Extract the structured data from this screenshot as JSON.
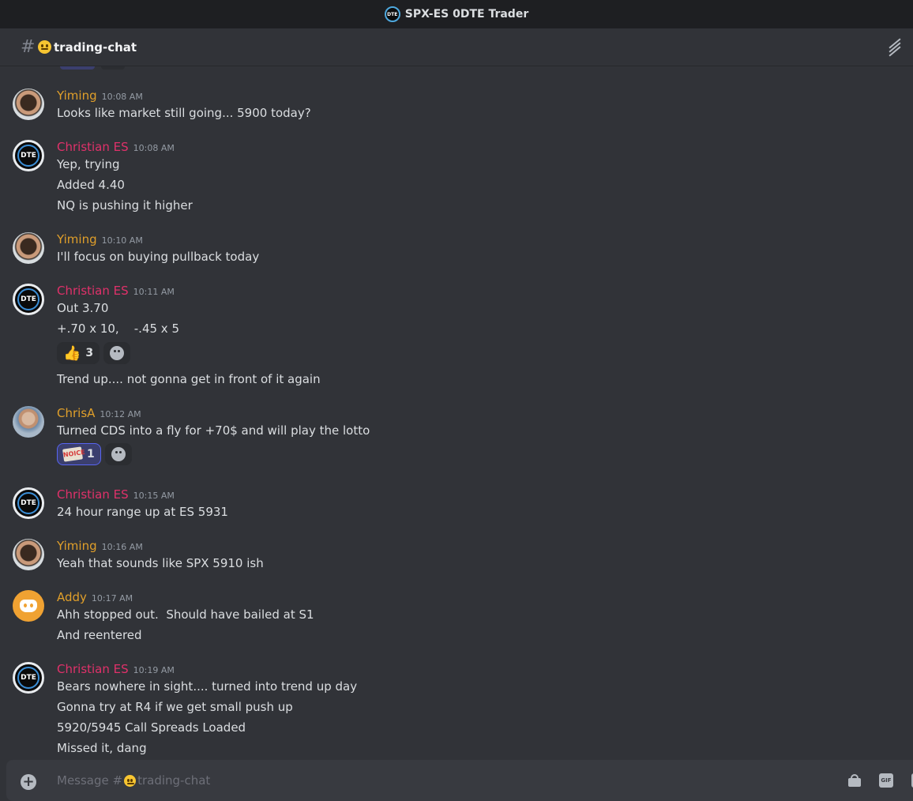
{
  "server": {
    "title": "SPX-ES 0DTE Trader",
    "icon_text": "DTE"
  },
  "channel": {
    "name": "trading-chat"
  },
  "composer": {
    "placeholder_prefix": "Message #",
    "placeholder_channel": "trading-chat",
    "gif_label": "GIF"
  },
  "messages": [
    {
      "author": "Yiming",
      "time": "10:08 AM",
      "lines": [
        "Looks like market still going... 5900 today?"
      ]
    },
    {
      "author": "Christian ES",
      "time": "10:08 AM",
      "lines": [
        "Yep, trying",
        "Added 4.40",
        "NQ is pushing it higher"
      ]
    },
    {
      "author": "Yiming",
      "time": "10:10 AM",
      "lines": [
        "I'll focus on buying pullback today"
      ]
    },
    {
      "author": "Christian ES",
      "time": "10:11 AM",
      "lines": [
        "Out 3.70",
        "+.70 x 10,    -.45 x 5",
        "Trend up.... not gonna get in front of it again"
      ],
      "reaction": {
        "emoji": "thumbs-up",
        "count": "3"
      }
    },
    {
      "author": "ChrisA",
      "time": "10:12 AM",
      "lines": [
        "Turned CDS into a fly for +70$ and will play the lotto"
      ],
      "reaction": {
        "emoji": "noice",
        "emoji_text": "NOICE",
        "count": "1"
      }
    },
    {
      "author": "Christian ES",
      "time": "10:15 AM",
      "lines": [
        "24 hour range up at ES 5931"
      ]
    },
    {
      "author": "Yiming",
      "time": "10:16 AM",
      "lines": [
        "Yeah that sounds like SPX 5910 ish"
      ]
    },
    {
      "author": "Addy",
      "time": "10:17 AM",
      "lines": [
        "Ahh stopped out.  Should have bailed at S1",
        "And reentered"
      ]
    },
    {
      "author": "Christian ES",
      "time": "10:19 AM",
      "lines": [
        "Bears nowhere in sight.... turned into trend up day",
        "Gonna try at R4 if we get small push up",
        "5920/5945 Call Spreads Loaded",
        "Missed it, dang"
      ]
    }
  ]
}
